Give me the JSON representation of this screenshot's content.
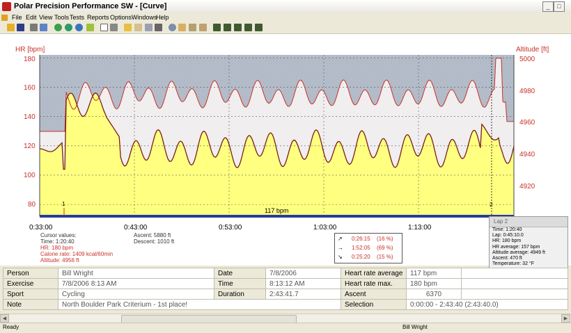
{
  "window": {
    "title": "Polar Precision Performance SW - [Curve]"
  },
  "menu": [
    "File",
    "Edit",
    "View",
    "Tools",
    "Tests",
    "Reports",
    "Options",
    "Windows",
    "Help"
  ],
  "toolbar_icons": [
    "open-icon",
    "save-icon",
    "print-icon",
    "copy-icon",
    "paste-icon",
    "globe-icon",
    "clock-icon",
    "pen-icon",
    "window-icon",
    "zoom-icon",
    "line-chart-icon",
    "bar-chart-icon",
    "table-icon",
    "search-icon",
    "calendar-icon",
    "edit-icon",
    "settings-icon",
    "person-icon",
    "person-add-icon",
    "person-stats-icon",
    "person-group-icon"
  ],
  "chart": {
    "left_axis_title": "HR [bpm]",
    "right_axis_title": "Altitude [ft]",
    "hr_ticks": [
      "180",
      "160",
      "140",
      "120",
      "100",
      "80"
    ],
    "alt_ticks": [
      "5000",
      "4980",
      "4960",
      "4940",
      "4920"
    ],
    "time_ticks": [
      "0:33:00",
      "0:43:00",
      "0:53:00",
      "1:03:00",
      "1:13:00"
    ],
    "lap_markers": [
      "1",
      "2"
    ],
    "hr_line_label": "117 bpm",
    "colors": {
      "hr_fill": "#ffff80",
      "altitude_fill": "#f0eeee",
      "line": "#c8312a",
      "grid_above": "#b9c1cc",
      "baseline_bar": "#283c9c"
    }
  },
  "chart_data": {
    "type": "area",
    "x_range": [
      "0:28:00",
      "1:25:00"
    ],
    "xlabel": "",
    "series": [
      {
        "name": "HR [bpm]",
        "ylim": [
          72,
          182
        ]
      },
      {
        "name": "Altitude [ft]",
        "ylim": [
          4905,
          5002
        ]
      }
    ],
    "reference_line": {
      "value": 117,
      "label": "117 bpm"
    }
  },
  "cursor": {
    "title": "Cursor values:",
    "time": "Time: 1:20:40",
    "hr": "HR: 180 bpm",
    "calorie": "Calorie rate: 1409 kcal/60min",
    "altitude": "Altitude: 4956 ft",
    "ascent": "Ascent: 5880 ft",
    "descent": "Descent: 1010 ft"
  },
  "zones": [
    {
      "arrow": "↗",
      "time": "0:26:15",
      "pct": "(16 %)"
    },
    {
      "arrow": "→",
      "time": "1:52:05",
      "pct": "(69 %)"
    },
    {
      "arrow": "↘",
      "time": "0:25:20",
      "pct": "(15 %)"
    }
  ],
  "lap_popup": {
    "header": "Lap 2",
    "lines": [
      "Time: 1:20:40",
      "Lap: 0:45:10.0",
      "HR: 180 bpm",
      "HR average: 157 bpm",
      "Altitude average: 4949 ft",
      "Ascent: 470 ft",
      "Temperature: 32 °F"
    ]
  },
  "info": {
    "person_label": "Person",
    "person_value": "Bill Wright",
    "date_label": "Date",
    "date_value": "7/8/2006",
    "hravg_label": "Heart rate average",
    "hravg_value": "117 bpm",
    "exercise_label": "Exercise",
    "exercise_value": "7/8/2006 8:13 AM",
    "time_label": "Time",
    "time_value": "8:13:12 AM",
    "hrmax_label": "Heart rate max.",
    "hrmax_value": "180 bpm",
    "sport_label": "Sport",
    "sport_value": "Cycling",
    "duration_label": "Duration",
    "duration_value": "2:43:41.7",
    "ascent_label": "Ascent",
    "ascent_value": "6370",
    "note_label": "Note",
    "note_value": "North Boulder Park Criterium - 1st place!",
    "selection_label": "Selection",
    "selection_value": "0:00:00 - 2:43:40 (2:43:40.0)"
  },
  "status": {
    "left": "Ready",
    "user": "Bill Wright"
  }
}
